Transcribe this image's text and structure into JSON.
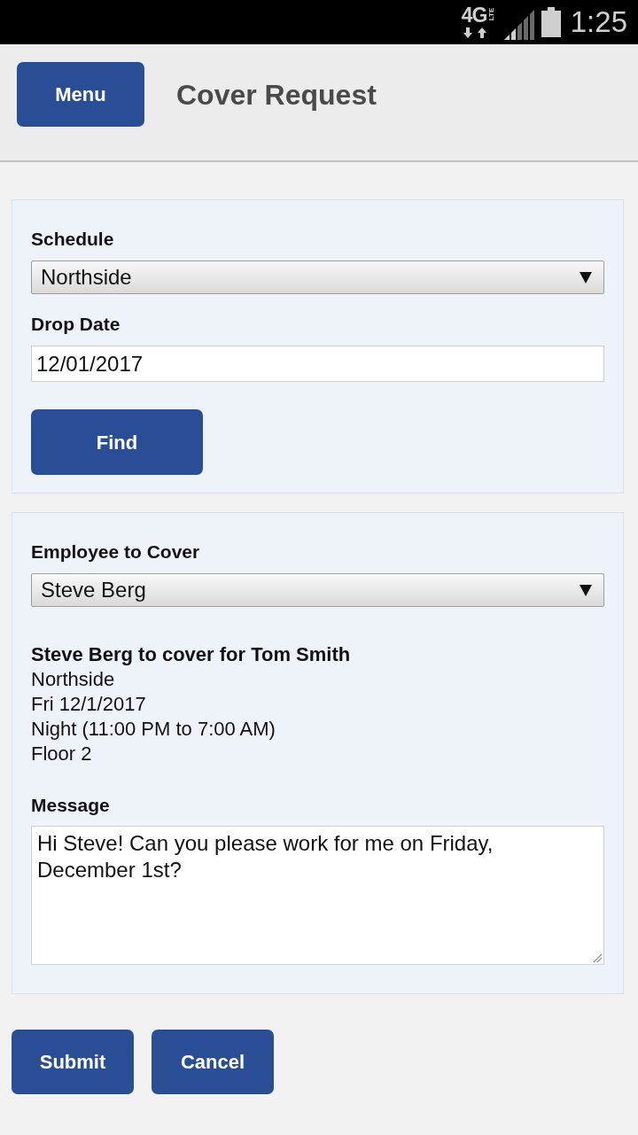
{
  "status_bar": {
    "network": "4G",
    "network_badge": "LTE",
    "time": "1:25"
  },
  "header": {
    "menu_button": "Menu",
    "title": "Cover Request"
  },
  "search_panel": {
    "fields": [
      {
        "kind": "select",
        "label": "Schedule",
        "value": "Northside"
      },
      {
        "kind": "input",
        "label": "Drop Date",
        "value": "12/01/2017"
      }
    ],
    "button": "Find"
  },
  "request_panel": {
    "fields": [
      {
        "kind": "select",
        "label": "Employee to Cover",
        "value": "Steve Berg"
      }
    ],
    "summary": {
      "heading": "Steve Berg to cover for Tom Smith",
      "lines": [
        "Northside",
        "Fri 12/1/2017",
        "Night (11:00 PM to 7:00 AM)",
        "Floor 2"
      ]
    },
    "message": {
      "kind": "textarea",
      "label": "Message",
      "value": "Hi Steve! Can you please work for me on Friday, December 1st?"
    }
  },
  "actions": [
    "Submit",
    "Cancel"
  ]
}
